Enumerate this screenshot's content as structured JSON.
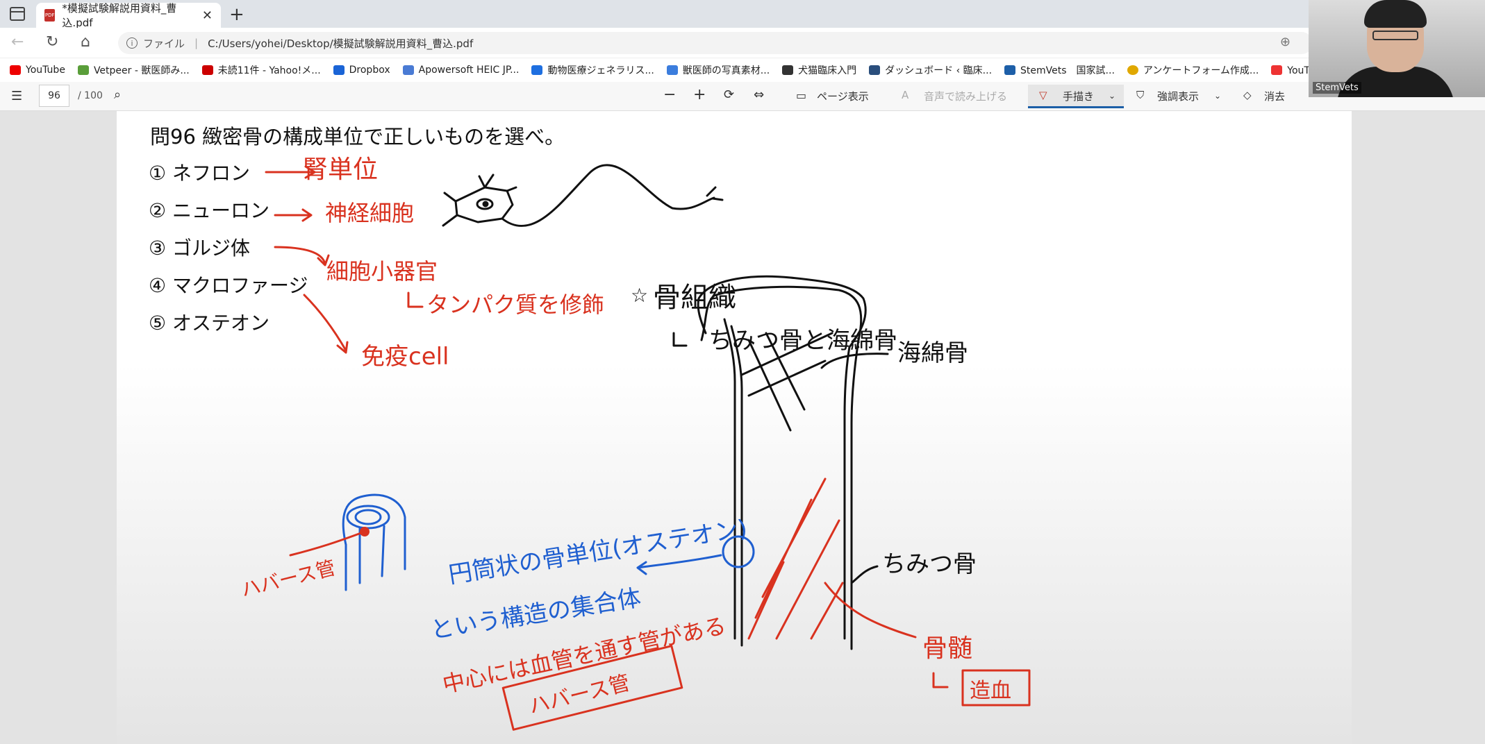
{
  "browser": {
    "tab_title": "*模擬試験解説用資料_曹込.pdf",
    "url_label": "ファイル",
    "url": "C:/Users/yohei/Desktop/模擬試験解説用資料_曹込.pdf"
  },
  "bookmarks": [
    {
      "label": "YouTube",
      "color": "#e00"
    },
    {
      "label": "Vetpeer - 獣医師み...",
      "color": "#5a9e3a"
    },
    {
      "label": "未読11件 - Yahoo!メ...",
      "color": "#c00"
    },
    {
      "label": "Dropbox",
      "color": "#1a64d6"
    },
    {
      "label": "Apowersoft HEIC JP...",
      "color": "#4a7bd4"
    },
    {
      "label": "動物医療ジェネラリス...",
      "color": "#1e6fe0"
    },
    {
      "label": "獣医師の写真素材...",
      "color": "#3b7ddd"
    },
    {
      "label": "犬猫臨床入門",
      "color": "#333"
    },
    {
      "label": "ダッシュボード ‹ 臨床...",
      "color": "#2a4e7c"
    },
    {
      "label": "StemVets　国家試...",
      "color": "#1d5fa8"
    },
    {
      "label": "アンケートフォーム作成...",
      "color": "#e0a800"
    },
    {
      "label": "YouTubeからのビデオ...",
      "color": "#e33"
    }
  ],
  "pdf_toolbar": {
    "page_number": "96",
    "page_total": "/ 100",
    "page_view": "ページ表示",
    "read_aloud": "音声で読み上げる",
    "draw": "手描き",
    "highlight": "強調表示",
    "erase": "消去"
  },
  "webcam": {
    "name": "StemVets"
  },
  "document": {
    "question": "問96 緻密骨の構成単位で正しいものを選べ。",
    "options": [
      "① ネフロン",
      "② ニューロン",
      "③ ゴルジ体",
      "④ マクロファージ",
      "⑤ オステオン"
    ]
  },
  "annotations": {
    "opt1_note": "腎単位",
    "opt2_note": "神経細胞",
    "opt3_note": "細胞小器官",
    "opt3_sub": "タンパク質を修飾",
    "opt4_note": "免疫cell",
    "title_note": "骨組織",
    "title_sub": "ちみつ骨と海綿骨",
    "spongy": "海綿骨",
    "compact": "ちみつ骨",
    "marrow": "骨髄",
    "hematopoiesis": "造血",
    "havers_label": "ハバース管",
    "osteon_line1": "円筒状の骨単位(オステオン)",
    "osteon_line2": "という構造の集合体",
    "osteon_line3": "中心には血管を通す管がある",
    "havers_box": "ハバース管"
  },
  "colors": {
    "red_ink": "#d9321f",
    "blue_ink": "#1f5fd0",
    "black_ink": "#111111",
    "accent": "#1b5ea6"
  }
}
